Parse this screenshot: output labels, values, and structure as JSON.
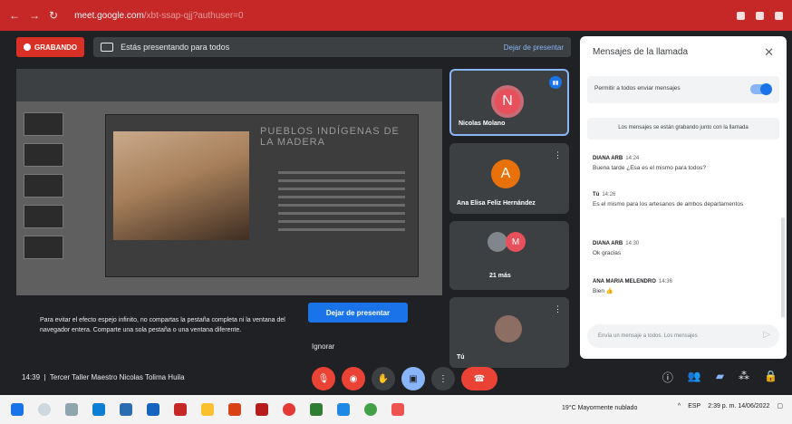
{
  "browser": {
    "url_host": "meet.google.com",
    "url_path": "/xbt-ssap-qjj?authuser=0"
  },
  "topbar": {
    "recording_label": "GRABANDO",
    "presenting_text": "Estás presentando para todos",
    "stop_presenting_link": "Dejar de presentar"
  },
  "slide": {
    "title": "PUEBLOS INDÍGENAS DE LA MADERA"
  },
  "mirror_warning": {
    "text": "Para evitar el efecto espejo infinito, no compartas la pestaña completa ni la ventana del navegador entera. Comparte una sola pestaña o una ventana diferente.",
    "stop_button": "Dejar de presentar",
    "ignore_button": "Ignorar"
  },
  "participants": [
    {
      "name": "Nicolas Molano",
      "initial": "N",
      "color": "#e8505b"
    },
    {
      "name": "Ana Elisa Feliz Hernández",
      "initial": "A",
      "color": "#e8710a"
    },
    {
      "name": "21 más",
      "initial": "M",
      "color": "#e8505b"
    },
    {
      "name": "Tú",
      "initial": "",
      "color": "#5f6368"
    }
  ],
  "chat": {
    "title": "Mensajes de la llamada",
    "allow_label": "Permitir a todos enviar mensajes",
    "notice": "Los mensajes se están grabando junto con la llamada",
    "messages": [
      {
        "sender": "DIANA ARB",
        "time": "14:24",
        "body": "Buena tarde ¿Esa es el mismo para todos?"
      },
      {
        "sender": "Tú",
        "time": "14:26",
        "body": "Es el mismo para los artesanos de ambos departamentos"
      },
      {
        "sender": "DIANA ARB",
        "time": "14:30",
        "body": "Ok gracias"
      },
      {
        "sender": "ANA MARIA MELENDRO",
        "time": "14:36",
        "body": "Bien 👍"
      }
    ],
    "input_placeholder": "Envía un mensaje a todos. Los mensajes"
  },
  "bottom": {
    "time": "14:39",
    "meeting_name": "Tercer Taller Maestro Nicolas Tolima Huila"
  },
  "taskbar": {
    "weather": "19°C Mayormente nublado",
    "lang": "ESP",
    "clock_time": "2:39 p. m.",
    "clock_date": "14/06/2022"
  }
}
